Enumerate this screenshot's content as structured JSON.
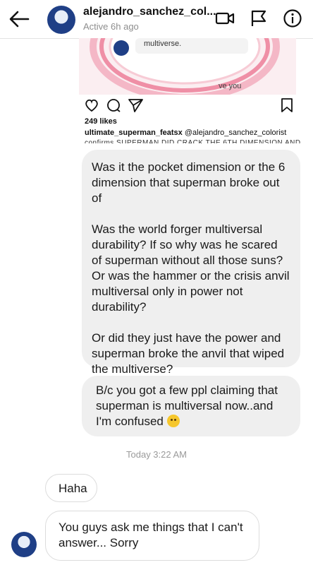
{
  "header": {
    "username": "alejandro_sanchez_col...",
    "status": "Active 6h ago",
    "icons": [
      "back-arrow-icon",
      "video-call-icon",
      "flag-icon",
      "info-icon"
    ]
  },
  "shared_post": {
    "image_text_1": "multiverse.",
    "image_text_2": "ve you",
    "likes": "249 likes",
    "caption_user": "ultimate_superman_featsx",
    "caption_mention": "@alejandro_sanchez_colorist",
    "caption_cut": "confirms SUPERMAN DID CRACK THE 6TH DIMENSION AND"
  },
  "messages": {
    "m1_p1": "Was it the pocket dimension or the 6 dimension that superman broke out of",
    "m1_p2": "Was the world forger multiversal durability? If so why was he scared of superman without all those suns? Or was the hammer or the crisis anvil multiversal only in power not durability?",
    "m1_p3": "Or did they just have the power and superman broke the anvil that wiped the multiverse?",
    "m2": "B/c you got a few ppl claiming that superman is multiversal now..and I'm confused",
    "timestamp": "Today 3:22 AM",
    "r1": "Haha",
    "r2": "You guys ask me things that I can't answer... Sorry"
  },
  "colors": {
    "bubble_gray": "#efefef",
    "header_text": "#111111",
    "muted": "#8e8e8e"
  }
}
